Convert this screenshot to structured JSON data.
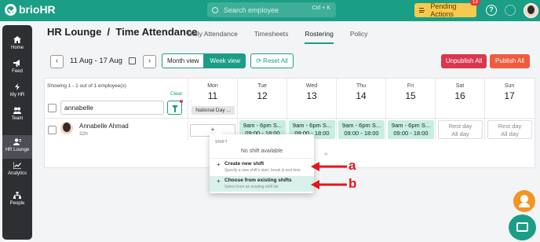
{
  "topbar": {
    "brand": "brioHR",
    "search_placeholder": "Search employee",
    "search_shortcut": "Ctrl + K",
    "pending_label": "Pending Actions",
    "pending_count": "13",
    "help_glyph": "?"
  },
  "sidebar": {
    "items": [
      {
        "label": "Home",
        "icon": "home-icon"
      },
      {
        "label": "Feed",
        "icon": "megaphone-icon"
      },
      {
        "label": "My HR",
        "icon": "bolt-icon"
      },
      {
        "label": "Team",
        "icon": "team-icon"
      },
      {
        "label": "HR Lounge",
        "icon": "hr-lounge-icon",
        "active": true
      },
      {
        "label": "Analytics",
        "icon": "analytics-icon"
      },
      {
        "label": "People",
        "icon": "people-icon"
      }
    ]
  },
  "header": {
    "title": "HR Lounge  /  Time Attendance",
    "tabs": [
      {
        "label": "Daily Attendance"
      },
      {
        "label": "Timesheets"
      },
      {
        "label": "Rostering",
        "active": true
      },
      {
        "label": "Policy"
      }
    ]
  },
  "controls": {
    "prev": "‹",
    "next": "›",
    "date_range": "11 Aug - 17 Aug",
    "month_view": "Month view",
    "week_view": "Week view",
    "reset_all": "Reset All",
    "unpublish_all": "Unpublish All",
    "publish_all": "Publish All"
  },
  "grid": {
    "showing": "Showing 1 - 1 out of 1 employee(s)",
    "clear": "Clear",
    "employee_filter_value": "annabelle",
    "days": [
      {
        "name": "Mon",
        "num": "11"
      },
      {
        "name": "Tue",
        "num": "12"
      },
      {
        "name": "Wed",
        "num": "13"
      },
      {
        "name": "Thu",
        "num": "14"
      },
      {
        "name": "Fri",
        "num": "15"
      },
      {
        "name": "Sat",
        "num": "16"
      },
      {
        "name": "Sun",
        "num": "17"
      }
    ],
    "holiday": "National Day ...",
    "employee": {
      "name": "Annabelle Ahmad",
      "hours": "32h"
    },
    "add_shift": "+",
    "cells": [
      {
        "line1": "9am - 6pm S...",
        "line2": "09:00 - 18:00"
      },
      {
        "line1": "9am - 6pm S...",
        "line2": "09:00 - 18:00"
      },
      {
        "line1": "9am - 6pm S...",
        "line2": "09:00 - 18:00"
      },
      {
        "line1": "9am - 6pm S...",
        "line2": "09:00 - 18:00"
      },
      {
        "line1": "Rest day",
        "line2": "All day"
      },
      {
        "line1": "Rest day",
        "line2": "All day"
      }
    ],
    "more": "»"
  },
  "popup": {
    "heading": "SHIFT",
    "none": "No shift available",
    "options": [
      {
        "title": "Create new shift",
        "subtitle": "Specify a new shift's start, break & end time"
      },
      {
        "title": "Choose from existing shifts",
        "subtitle": "Select from an existing shift list"
      }
    ]
  },
  "annotations": {
    "a": "a",
    "b": "b"
  },
  "colors": {
    "brand": "#1a9e85",
    "pending": "#f6c94f",
    "unpublish": "#d9374f",
    "publish": "#f05a3e",
    "annotation": "#e3171b"
  }
}
